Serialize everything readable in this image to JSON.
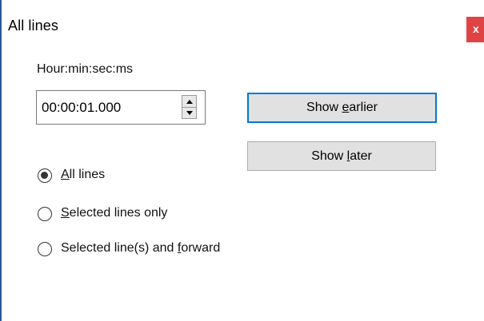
{
  "window": {
    "title": "All lines",
    "close_glyph": "x"
  },
  "time": {
    "label": "Hour:min:sec:ms",
    "value": "00:00:01.000"
  },
  "buttons": {
    "earlier": {
      "pre": "Show ",
      "mnemonic": "e",
      "post": "arlier"
    },
    "later": {
      "pre": "Show ",
      "mnemonic": "l",
      "post": "ater"
    }
  },
  "options": [
    {
      "pre": "",
      "mnemonic": "A",
      "post": "ll lines",
      "checked": true
    },
    {
      "pre": "",
      "mnemonic": "S",
      "post": "elected lines only",
      "checked": false
    },
    {
      "pre": "Selected line(s) and ",
      "mnemonic": "f",
      "post": "orward",
      "checked": false
    }
  ],
  "colors": {
    "accent": "#0078d7",
    "close": "#e04343",
    "window_border": "#2b579a"
  }
}
